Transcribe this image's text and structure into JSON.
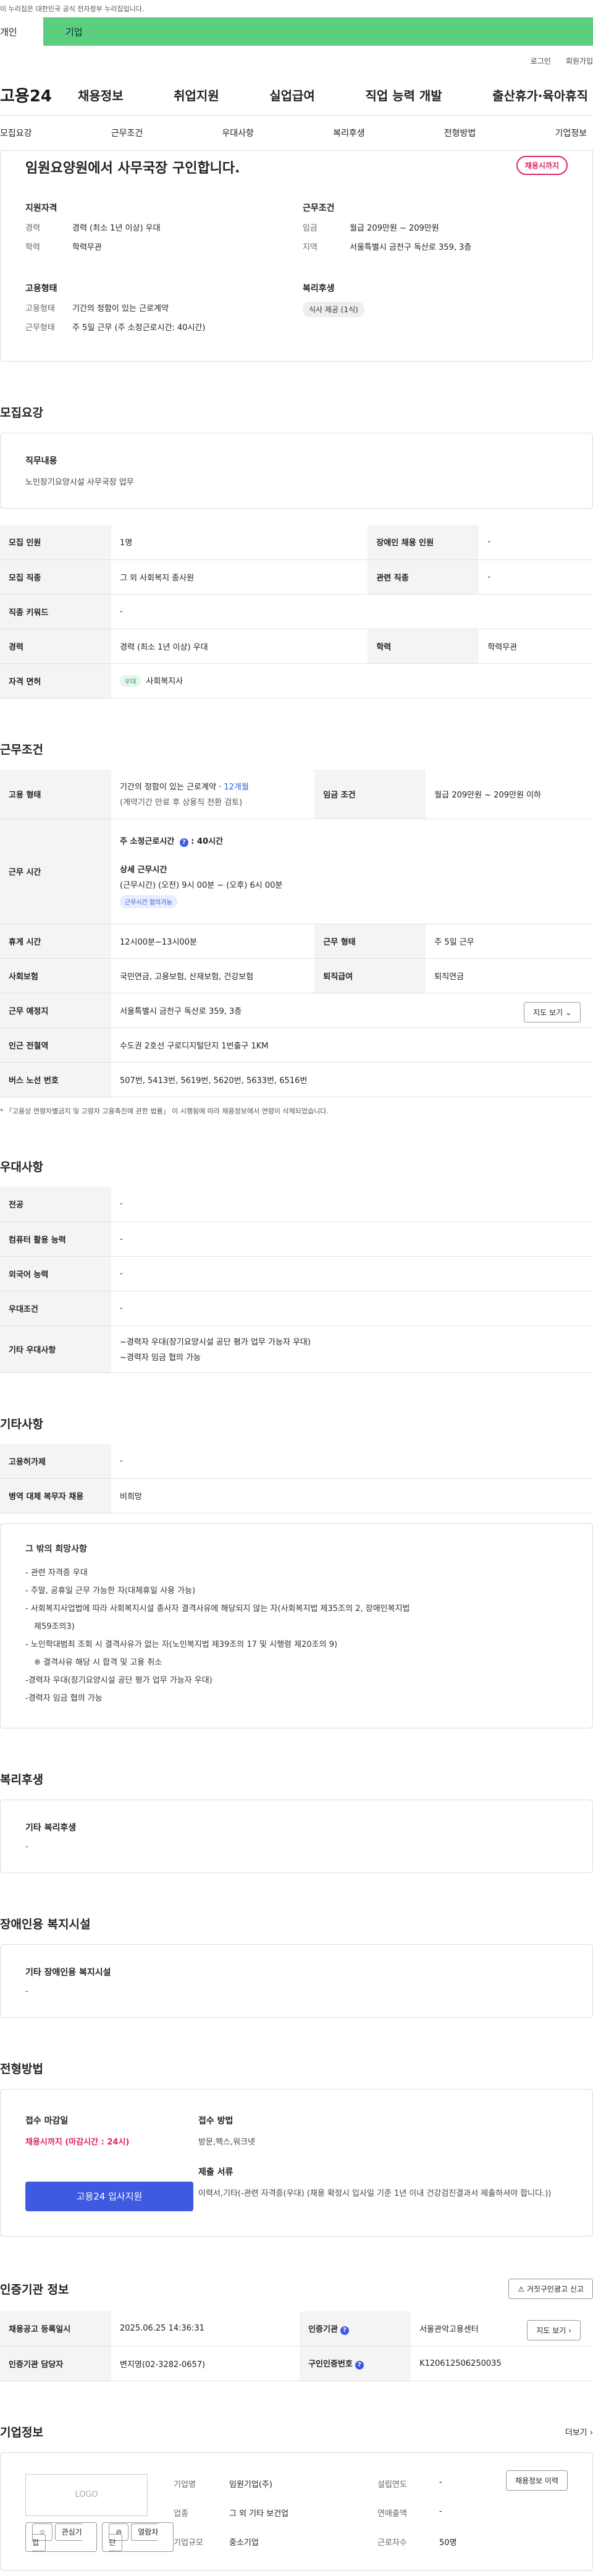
{
  "gov_notice": "이 누리집은 대한민국 공식 전자정부 누리집입니다.",
  "top_tabs": [
    "개인",
    "기업"
  ],
  "util": [
    "로그인",
    "회원가입"
  ],
  "logo": "고용24",
  "gnb": [
    "채용정보",
    "취업지원",
    "실업급여",
    "직업 능력 개발",
    "출산휴가·육아휴직"
  ],
  "snb": [
    "모집요강",
    "근무조건",
    "우대사항",
    "복리후생",
    "전형방법",
    "기업정보"
  ],
  "summary": {
    "title": "임원요양원에서 사무국장 구인합니다.",
    "deadline_badge": "채용시까지",
    "qual_h": "지원자격",
    "qual": [
      [
        "경력",
        "경력 (최소 1년 이상) 우대"
      ],
      [
        "학력",
        "학력무관"
      ]
    ],
    "cond_h": "근무조건",
    "cond": [
      [
        "임금",
        "월급 209만원 ~ 209만원"
      ],
      [
        "지역",
        "서울특별시 금천구 독산로 359, 3층"
      ]
    ],
    "form_h": "고용형태",
    "form": [
      [
        "고용형태",
        "기간의 정함이 있는 근로계약"
      ],
      [
        "근무형태",
        "주 5일 근무 (주 소정근로시간: 40시간)"
      ]
    ],
    "welfare_h": "복리후생",
    "welfare_chip": "식사 제공 (1식)"
  },
  "recruit": {
    "heading": "모집요강",
    "job_h": "직무내용",
    "job_desc": "노인장기요양시설 사무국장 업무",
    "rows": [
      [
        "모집 인원",
        "1명",
        "장애인 채용 인원",
        "-"
      ],
      [
        "모집 직종",
        "그 외 사회복지 종사원",
        "관련 직종",
        "-"
      ],
      [
        "직종 키워드",
        "-",
        "",
        ""
      ],
      [
        "경력",
        "경력 (최소 1년 이상) 우대",
        "학력",
        "학력무관"
      ]
    ],
    "license_k": "자격 면허",
    "license_tag": "우대",
    "license_v": "사회복지사"
  },
  "work": {
    "heading": "근무조건",
    "form_k": "고용 형태",
    "form_v1": "기간의 정함이 있는 근로계약 · ",
    "form_v1b": "12개월",
    "form_v2": "(계약기간 만료 후 상용직 전환 검토)",
    "wage_k": "임금 조건",
    "wage_v": "월급 209만원 ~ 209만원 이하",
    "time_k": "근무 시간",
    "time_v1": "주 소정근로시간",
    "time_v1b": "40시간",
    "time_v2": "상세 근무시간",
    "time_v3": "(근무시간) (오전) 9시 00분 ~ (오후) 6시 00분",
    "time_tag": "근무시간 협의가능",
    "rest_k": "휴게 시간",
    "rest_v": "12시00분~13시00분",
    "shift_k": "근무 형태",
    "shift_v": "주 5일 근무",
    "ins_k": "사회보험",
    "ins_v": "국민연금, 고용보험, 산재보험, 건강보험",
    "ret_k": "퇴직급여",
    "ret_v": "퇴직연금",
    "place_k": "근무 예정지",
    "place_v": "서울특별시 금천구 독산로 359, 3층",
    "map_btn": "지도 보기",
    "sub_k": "인근 전철역",
    "sub_v": "수도권 2호선 구로디지털단지 1번출구 1KM",
    "bus_k": "버스 노선 번호",
    "bus_v": "507번, 5413번, 5619번, 5620번, 5633번, 6516번",
    "note": "* 「고용상 연령차별금지 및 고령자 고용촉진에 관한 법률」 이 시행됨에 따라 채용정보에서 연령이 삭제되었습니다."
  },
  "pref": {
    "heading": "우대사항",
    "rows": [
      [
        "전공",
        "-"
      ],
      [
        "컴퓨터 활용 능력",
        "-"
      ],
      [
        "외국어 능력",
        "-"
      ],
      [
        "우대조건",
        "-"
      ]
    ],
    "etc_k": "기타 우대사항",
    "etc_v1": "~경력자 우대(장기요양시설 공단 평가 업무 가능자 우대)",
    "etc_v2": "~경력자 임금 협의 가능"
  },
  "other": {
    "heading": "기타사항",
    "rows": [
      [
        "고용허가제",
        "-"
      ],
      [
        "병역 대체 복무자 채용",
        "비희망"
      ]
    ],
    "box_h": "그 밖의 희망사항",
    "lines": [
      "- 관련 자격증 우대",
      "- 주말, 공휴일 근무 가능한 자(대체휴일 사용 가능)",
      "- 사회복지사업법에 따라 사회복지시설 종사자 결격사유에 해당되지 않는 자(사회복지법 제35조의 2, 장애인복지법",
      "   제59조의3)",
      "- 노인학대범죄 조회 시 결격사유가 없는 자(노인복지법 제39조의 17 및 시행령 제20조의 9)",
      "   ※ 결격사유 해당 시 합격 및 고용 취소",
      "-경력자 우대(장기요양시설 공단 평가 업무 가능자 우대)",
      "-경력자 임금 협의 가능"
    ]
  },
  "benefit": {
    "heading": "복리후생",
    "box_h": "기타 복리후생",
    "box_v": "-"
  },
  "disabled": {
    "heading": "장애인용 복지시설",
    "box_h": "기타 장애인용 복지시설",
    "box_v": "-"
  },
  "apply": {
    "heading": "전형방법",
    "deadline_h": "접수 마감일",
    "deadline_v": "채용시까지 (마감시간 : 24시)",
    "method_h": "접수 방법",
    "method_v": "방문,팩스,워크넷",
    "docs_h": "제출 서류",
    "docs_v": "이력서,기타(-관련 자격증(우대) (채용 확정시 입사일 기준 1년 이내 건강검진결과서 제출하셔야 합니다.))",
    "apply_btn": "고용24 입사지원"
  },
  "agency": {
    "heading": "인증기관 정보",
    "report_btn": "거짓구인광고 신고",
    "reg_k": "채용공고 등록일시",
    "reg_v": "2025.06.25 14:36:31",
    "org_k": "인증기관",
    "org_v": "서울관악고용센터",
    "map_btn": "지도 보기",
    "mgr_k": "인증기관 담당자",
    "mgr_v": "변지영(02-3282-0657)",
    "id_k": "구인인증번호",
    "id_v": "K120612506250035"
  },
  "company": {
    "heading": "기업정보",
    "more": "더보기",
    "logo_text": "LOGO",
    "fav_btn": "관심기업",
    "block_btn": "열람차단",
    "history_btn": "채용정보 이력",
    "rows": [
      [
        "기업명",
        "임원기업(주)",
        "설립연도",
        "-"
      ],
      [
        "업종",
        "그 외 기타 보건업",
        "연매출액",
        "-"
      ],
      [
        "기업규모",
        "중소기업",
        "근로자수",
        "50명"
      ]
    ]
  }
}
